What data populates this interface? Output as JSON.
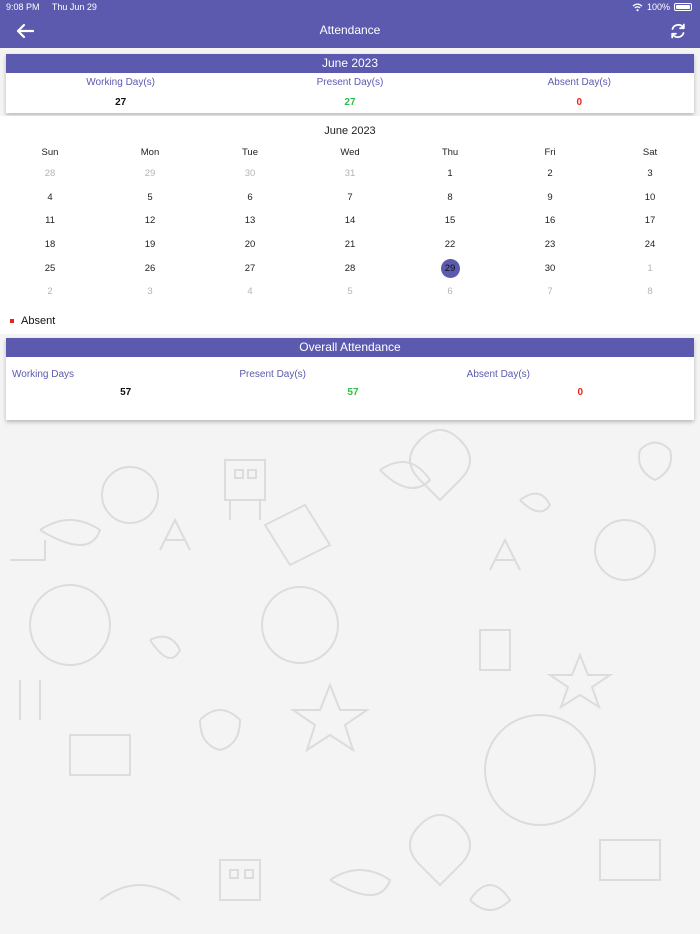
{
  "status_bar": {
    "time": "9:08 PM",
    "date": "Thu Jun 29",
    "battery": "100%"
  },
  "header": {
    "title": "Attendance"
  },
  "month_summary": {
    "title": "June 2023",
    "items": [
      {
        "label": "Working Day(s)",
        "value": "27"
      },
      {
        "label": "Present Day(s)",
        "value": "27"
      },
      {
        "label": "Absent Day(s)",
        "value": "0"
      }
    ]
  },
  "calendar": {
    "title": "June 2023",
    "weekdays": [
      "Sun",
      "Mon",
      "Tue",
      "Wed",
      "Thu",
      "Fri",
      "Sat"
    ],
    "weeks": [
      [
        "28",
        "29",
        "30",
        "31",
        "1",
        "2",
        "3"
      ],
      [
        "4",
        "5",
        "6",
        "7",
        "8",
        "9",
        "10"
      ],
      [
        "11",
        "12",
        "13",
        "14",
        "15",
        "16",
        "17"
      ],
      [
        "18",
        "19",
        "20",
        "21",
        "22",
        "23",
        "24"
      ],
      [
        "25",
        "26",
        "27",
        "28",
        "29",
        "30",
        "1"
      ],
      [
        "2",
        "3",
        "4",
        "5",
        "6",
        "7",
        "8"
      ]
    ],
    "today": "29"
  },
  "legend": {
    "absent_label": "Absent"
  },
  "overall": {
    "title": "Overall Attendance",
    "items": [
      {
        "label": "Working Days",
        "value": "57"
      },
      {
        "label": "Present Day(s)",
        "value": "57"
      },
      {
        "label": "Absent Day(s)",
        "value": "0"
      }
    ]
  },
  "colors": {
    "accent": "#5b5aae",
    "present": "#2fbe4a",
    "absent": "#e8251c",
    "muted_day": "#b4b4b4"
  }
}
